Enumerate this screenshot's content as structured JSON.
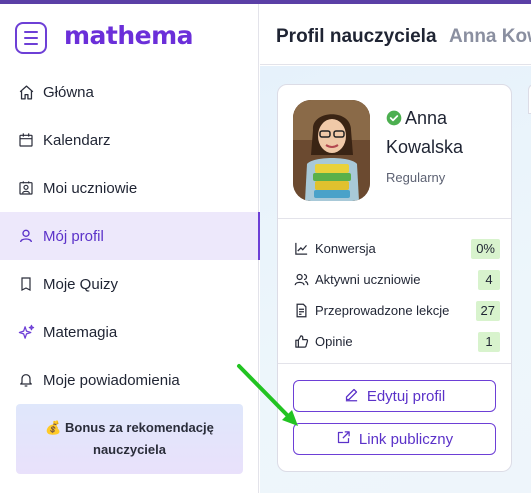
{
  "app": {
    "logo": "mathema"
  },
  "sidebar": {
    "items": [
      {
        "label": "Główna",
        "icon": "home-icon"
      },
      {
        "label": "Kalendarz",
        "icon": "calendar-icon"
      },
      {
        "label": "Moi uczniowie",
        "icon": "students-icon"
      },
      {
        "label": "Mój profil",
        "icon": "user-icon",
        "active": true
      },
      {
        "label": "Moje Quizy",
        "icon": "quiz-icon"
      },
      {
        "label": "Matemagia",
        "icon": "sparkle-icon"
      },
      {
        "label": "Moje powiadomienia",
        "icon": "bell-icon"
      }
    ],
    "bonus": {
      "emoji": "💰",
      "label": "Bonus za rekomendację nauczyciela"
    }
  },
  "header": {
    "title": "Profil nauczyciela",
    "subtitle": "Anna Kowalska"
  },
  "profile": {
    "first_name": "Anna",
    "last_name": "Kowalska",
    "level": "Regularny",
    "stats": [
      {
        "label": "Konwersja",
        "value": "0%",
        "icon": "chart-icon"
      },
      {
        "label": "Aktywni uczniowie",
        "value": "4",
        "icon": "users-icon"
      },
      {
        "label": "Przeprowadzone lekcje",
        "value": "27",
        "icon": "lessons-icon"
      },
      {
        "label": "Opinie",
        "value": "1",
        "icon": "thumbs-up-icon"
      }
    ],
    "edit_label": "Edytuj profil",
    "public_link_label": "Link publiczny"
  },
  "colors": {
    "accent": "#6d3fd6",
    "active_bg": "#ede8fb",
    "badge_bg": "#d8f3cd",
    "annotation_arrow": "#22c322"
  }
}
